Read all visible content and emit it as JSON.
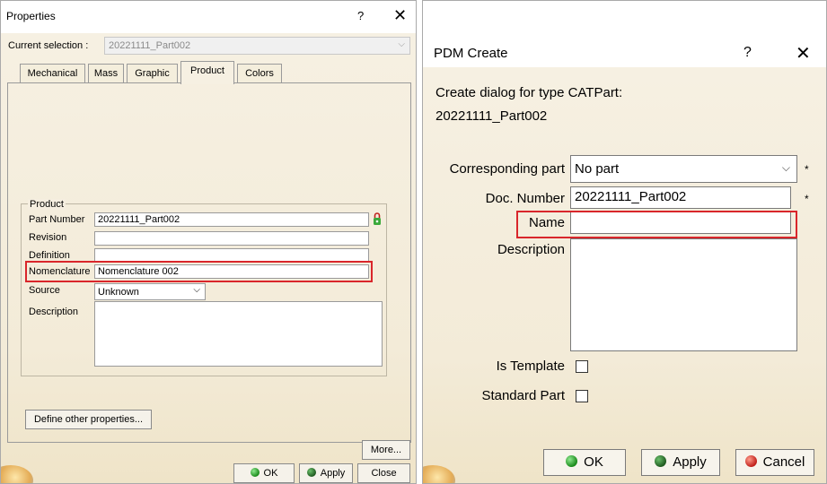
{
  "properties": {
    "title": "Properties",
    "help_glyph": "?",
    "close_glyph": "✕",
    "current_selection_label": "Current selection :",
    "current_selection_value": "20221111_Part002",
    "tabs": [
      "Mechanical",
      "Mass",
      "Graphic",
      "Product",
      "Colors"
    ],
    "active_tab": "Product",
    "group_title": "Product",
    "fields": {
      "part_number_label": "Part Number",
      "part_number_value": "20221111_Part002",
      "revision_label": "Revision",
      "revision_value": "",
      "definition_label": "Definition",
      "definition_value": "",
      "nomenclature_label": "Nomenclature",
      "nomenclature_value": "Nomenclature 002",
      "source_label": "Source",
      "source_value": "Unknown",
      "description_label": "Description",
      "description_value": ""
    },
    "define_other_properties_label": "Define other properties...",
    "more_label": "More...",
    "ok_label": "OK",
    "apply_label": "Apply",
    "close_label": "Close",
    "colors": {
      "highlight": "#d9262b",
      "lock": "#3aa93a"
    }
  },
  "pdm_create": {
    "title": "PDM Create",
    "help_glyph": "?",
    "close_glyph": "✕",
    "intro_line1": "Create dialog for type CATPart:",
    "intro_line2": "20221111_Part002",
    "corresponding_part_label": "Corresponding part",
    "corresponding_part_value": "No part",
    "doc_number_label": "Doc. Number",
    "doc_number_value": "20221111_Part002",
    "name_label": "Name",
    "name_value": "",
    "description_label": "Description",
    "description_value": "",
    "is_template_label": "Is Template",
    "is_template_checked": false,
    "standard_part_label": "Standard Part",
    "standard_part_checked": false,
    "required_mark": "*",
    "ok_label": "OK",
    "apply_label": "Apply",
    "cancel_label": "Cancel"
  }
}
